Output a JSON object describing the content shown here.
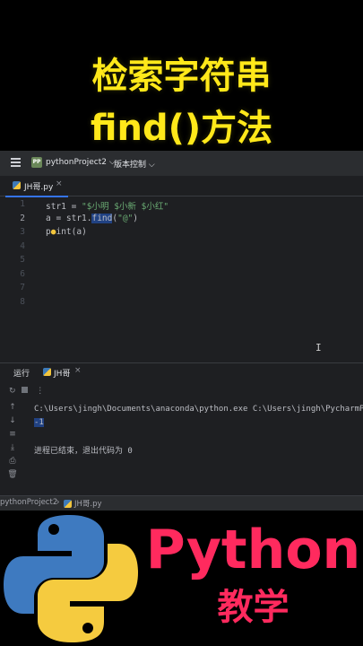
{
  "title_line1": "检索字符串",
  "title_line2": "find()方法",
  "ide": {
    "project_badge": "PP",
    "project_name": "pythonProject2",
    "vcs_menu": "版本控制",
    "tab_name": "JH哥.py",
    "lines": [
      {
        "num": "1",
        "text": "str1 = \"$小明 $小新 $小红\""
      },
      {
        "num": "2",
        "text": "a = str1.find(\"@\")"
      },
      {
        "num": "3",
        "text": "print(a)"
      },
      {
        "num": "4",
        "text": ""
      },
      {
        "num": "5",
        "text": ""
      },
      {
        "num": "6",
        "text": ""
      },
      {
        "num": "7",
        "text": ""
      },
      {
        "num": "8",
        "text": ""
      }
    ],
    "line1": {
      "var": "str1 = ",
      "str": "\"$小明 $小新 $小红\""
    },
    "line2": {
      "pre": "a = str1.",
      "sel": "find",
      "post": "(",
      "str": "\"@\"",
      "end": ")"
    },
    "line3": {
      "p": "p",
      "rest": "int(a)"
    },
    "run_tab_label": "运行",
    "run_config": "JH哥",
    "output": {
      "cmd": "C:\\Users\\jingh\\Documents\\anaconda\\python.exe C:\\Users\\jingh\\PycharmPr",
      "result": "-1",
      "exit_msg": "进程已结束，退出代码为 0"
    },
    "status": {
      "project": "pythonProject2",
      "file": "JH哥.py"
    }
  },
  "bottom": {
    "brand": "Python",
    "sub": "教学"
  }
}
